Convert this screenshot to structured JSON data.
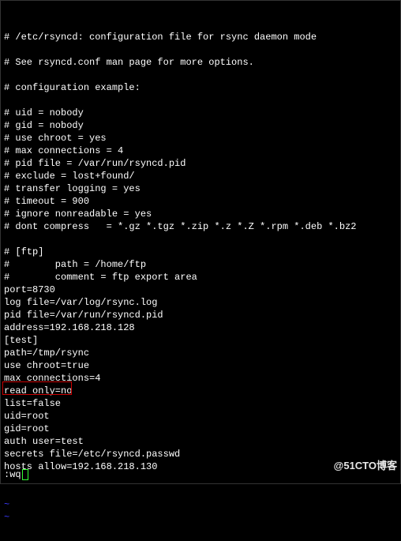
{
  "lines": [
    "# /etc/rsyncd: configuration file for rsync daemon mode",
    "",
    "# See rsyncd.conf man page for more options.",
    "",
    "# configuration example:",
    "",
    "# uid = nobody",
    "# gid = nobody",
    "# use chroot = yes",
    "# max connections = 4",
    "# pid file = /var/run/rsyncd.pid",
    "# exclude = lost+found/",
    "# transfer logging = yes",
    "# timeout = 900",
    "# ignore nonreadable = yes",
    "# dont compress   = *.gz *.tgz *.zip *.z *.Z *.rpm *.deb *.bz2",
    "",
    "# [ftp]",
    "#        path = /home/ftp",
    "#        comment = ftp export area",
    "port=8730",
    "log file=/var/log/rsync.log",
    "pid file=/var/run/rsyncd.pid",
    "address=192.168.218.128",
    "[test]",
    "path=/tmp/rsync",
    "use chroot=true",
    "max connections=4",
    "read only=no",
    "list=false",
    "uid=root",
    "gid=root",
    "auth user=test",
    "secrets file=/etc/rsyncd.passwd",
    "hosts allow=192.168.218.130"
  ],
  "tildes": [
    "~",
    "~"
  ],
  "command": ":wq",
  "watermark": "@51CTO博客",
  "highlighted_line_index": 29
}
